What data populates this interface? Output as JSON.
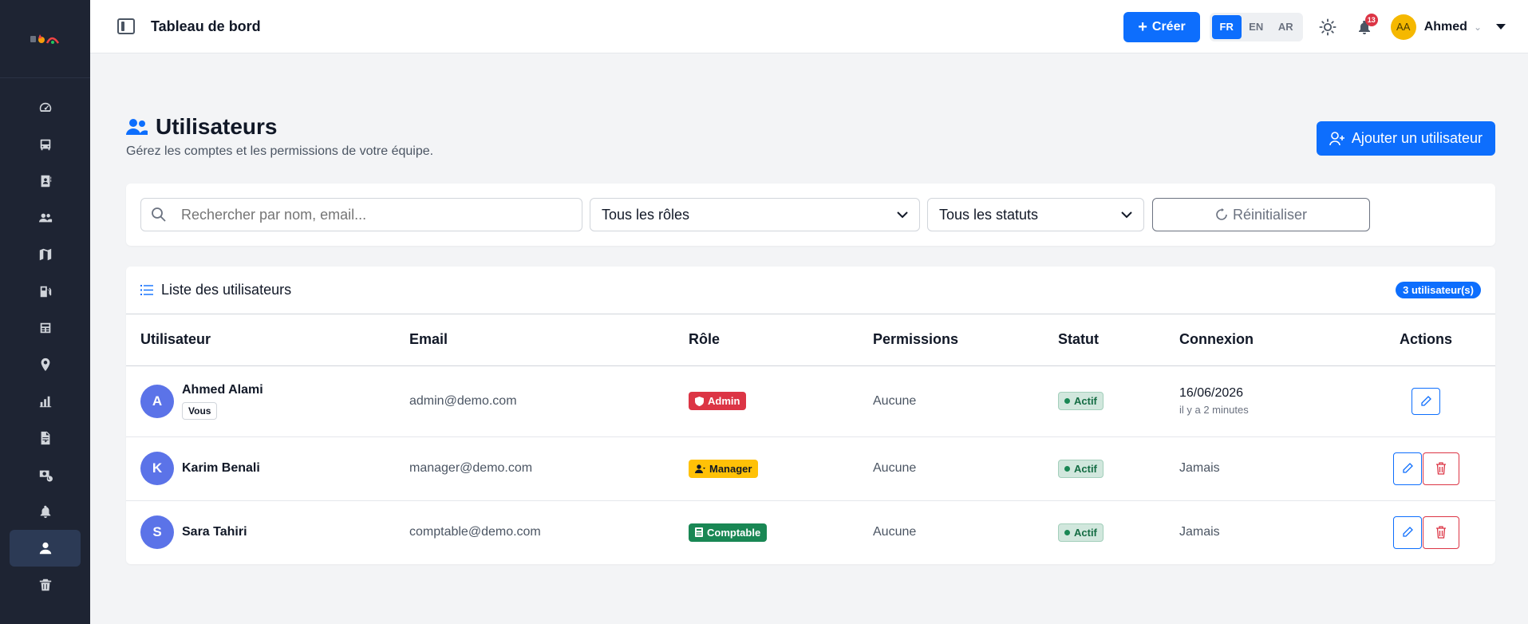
{
  "topbar": {
    "title": "Tableau de bord",
    "create_label": "Créer",
    "languages": [
      "FR",
      "EN",
      "AR"
    ],
    "active_language": "FR",
    "notification_count": "13",
    "user_initials": "AA",
    "user_name": "Ahmed"
  },
  "sidebar": {
    "items": [
      {
        "icon": "dashboard-icon"
      },
      {
        "icon": "bus-icon"
      },
      {
        "icon": "contact-book-icon"
      },
      {
        "icon": "users-icon"
      },
      {
        "icon": "map-icon"
      },
      {
        "icon": "fuel-pump-icon"
      },
      {
        "icon": "receipt-icon"
      },
      {
        "icon": "location-pin-icon"
      },
      {
        "icon": "bar-chart-icon"
      },
      {
        "icon": "file-invoice-icon"
      },
      {
        "icon": "money-history-icon"
      },
      {
        "icon": "bell-icon"
      },
      {
        "icon": "user-icon",
        "active": true
      },
      {
        "icon": "trash-icon"
      }
    ]
  },
  "page": {
    "title": "Utilisateurs",
    "subtitle": "Gérez les comptes et les permissions de votre équipe.",
    "add_button": "Ajouter un utilisateur"
  },
  "filters": {
    "search_placeholder": "Rechercher par nom, email...",
    "role_selected": "Tous les rôles",
    "status_selected": "Tous les statuts",
    "reset_label": "Réinitialiser"
  },
  "list": {
    "title": "Liste des utilisateurs",
    "count_label": "3 utilisateur(s)",
    "columns": [
      "Utilisateur",
      "Email",
      "Rôle",
      "Permissions",
      "Statut",
      "Connexion",
      "Actions"
    ],
    "rows": [
      {
        "initial": "A",
        "name": "Ahmed Alami",
        "tag": "Vous",
        "email": "admin@demo.com",
        "role": "Admin",
        "permissions": "Aucune",
        "status": "Actif",
        "connection": "16/06/2026",
        "connection_rel": "il y a 2 minutes"
      },
      {
        "initial": "K",
        "name": "Karim Benali",
        "email": "manager@demo.com",
        "role": "Manager",
        "permissions": "Aucune",
        "status": "Actif",
        "connection": "Jamais"
      },
      {
        "initial": "S",
        "name": "Sara Tahiri",
        "email": "comptable@demo.com",
        "role": "Comptable",
        "permissions": "Aucune",
        "status": "Actif",
        "connection": "Jamais"
      }
    ]
  },
  "colors": {
    "primary": "#0d6efd",
    "sidebar_bg": "#1e2433",
    "danger": "#dc3545",
    "warning": "#ffc107",
    "success": "#198754",
    "avatar_user": "#5b73e8",
    "avatar_top": "#f5b800"
  }
}
